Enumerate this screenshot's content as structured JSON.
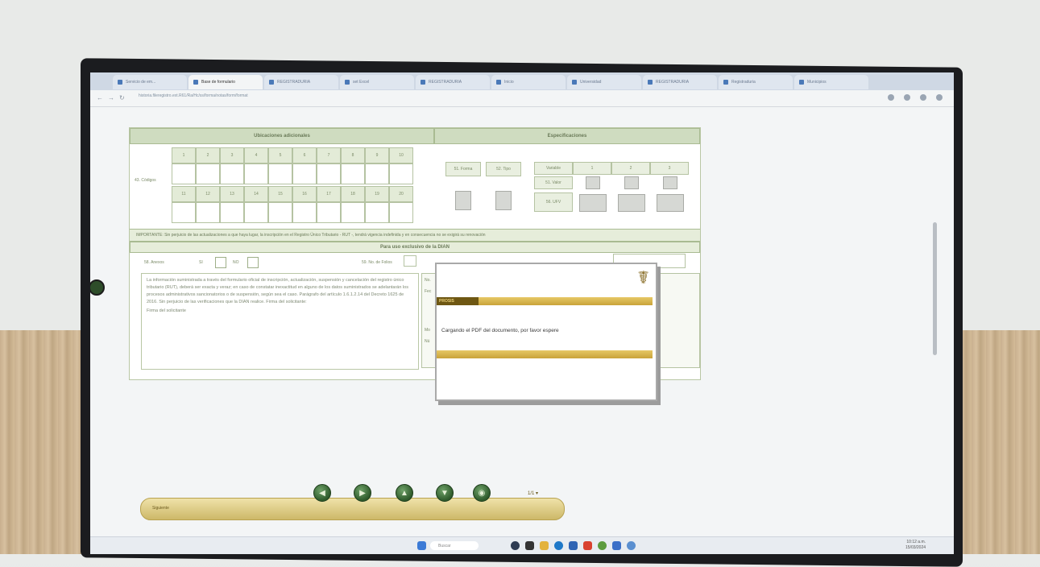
{
  "browser": {
    "tabs": [
      {
        "label": "Servicio de em..."
      },
      {
        "label": "Base de formulario"
      },
      {
        "label": "REGISTRADURIA"
      },
      {
        "label": "set Excel"
      },
      {
        "label": "REGISTRADURIA"
      },
      {
        "label": "Inicio"
      },
      {
        "label": "Universidad"
      },
      {
        "label": "REGISTRADURIA"
      },
      {
        "label": "Registraduria"
      },
      {
        "label": "Municipios"
      }
    ],
    "url": "historia.fileregistro.ext.R61/Ra/Hc/ss/forma/notas/form/format"
  },
  "form": {
    "section_left_title": "Ubicaciones adicionales",
    "section_right_title": "Especificaciones",
    "row_label": "43. Códigos",
    "numbers_top": [
      "1",
      "2",
      "3",
      "4",
      "5",
      "6",
      "7",
      "8",
      "9",
      "10"
    ],
    "numbers_bottom": [
      "11",
      "12",
      "13",
      "14",
      "15",
      "16",
      "17",
      "18",
      "19",
      "20"
    ],
    "spec_labels": [
      "51. Forma",
      "52. Tipo"
    ],
    "spec_table_header": [
      "Variable",
      "1",
      "2",
      "3"
    ],
    "spec_rows": [
      "51. Valor",
      "56. UFV"
    ],
    "important_note": "IMPORTANTE: Sin perjuicio de las actualizaciones a que haya lugar, la inscripción en el Registro Único Tributario - RUT -, tendrá vigencia indefinida y en consecuencia no se exigirá su renovación",
    "exclusive_title": "Para uso exclusivo de la DIAN",
    "anexos_label": "58. Anexos",
    "anexos_si": "SI",
    "anexos_no": "NO",
    "folios_label": "59. No. de Folios",
    "legal_text": "La información suministrada a través del formulario oficial de inscripción, actualización, suspensión y cancelación del registro único tributario (RUT), deberá ser exacta y veraz; en caso de constatar inexactitud en alguno de los datos suministrados se adelantarán los procesos administrativos sancionatorios o de suspensión, según sea el caso. Parágrafo del artículo 1.6.1.2.14 del Decreto 1625 de 2016. Sin perjuicio de las verificaciones que la DIAN realice. Firma del solicitante:",
    "signature_label": "Firma del solicitante",
    "right_labels": [
      "No.",
      "Fec",
      "Mo",
      "Nú"
    ]
  },
  "dialog": {
    "title": "PROSIS",
    "message": "Cargando el PDF del documento, por favor espere"
  },
  "toolbar": {
    "label": "Siguiente",
    "orb_icons": [
      "◀",
      "▶",
      "▲",
      "▼",
      "◉"
    ],
    "pager": "1/1 ▾"
  },
  "taskbar": {
    "search": "Buscar",
    "time": "10:12 a.m.",
    "date": "15/03/2024"
  },
  "colors": {
    "form_header": "#cfdcc0",
    "dialog_bar": "#c9a33a",
    "dialog_title_bg": "#6e5713",
    "orb": "#2e5a2b"
  }
}
